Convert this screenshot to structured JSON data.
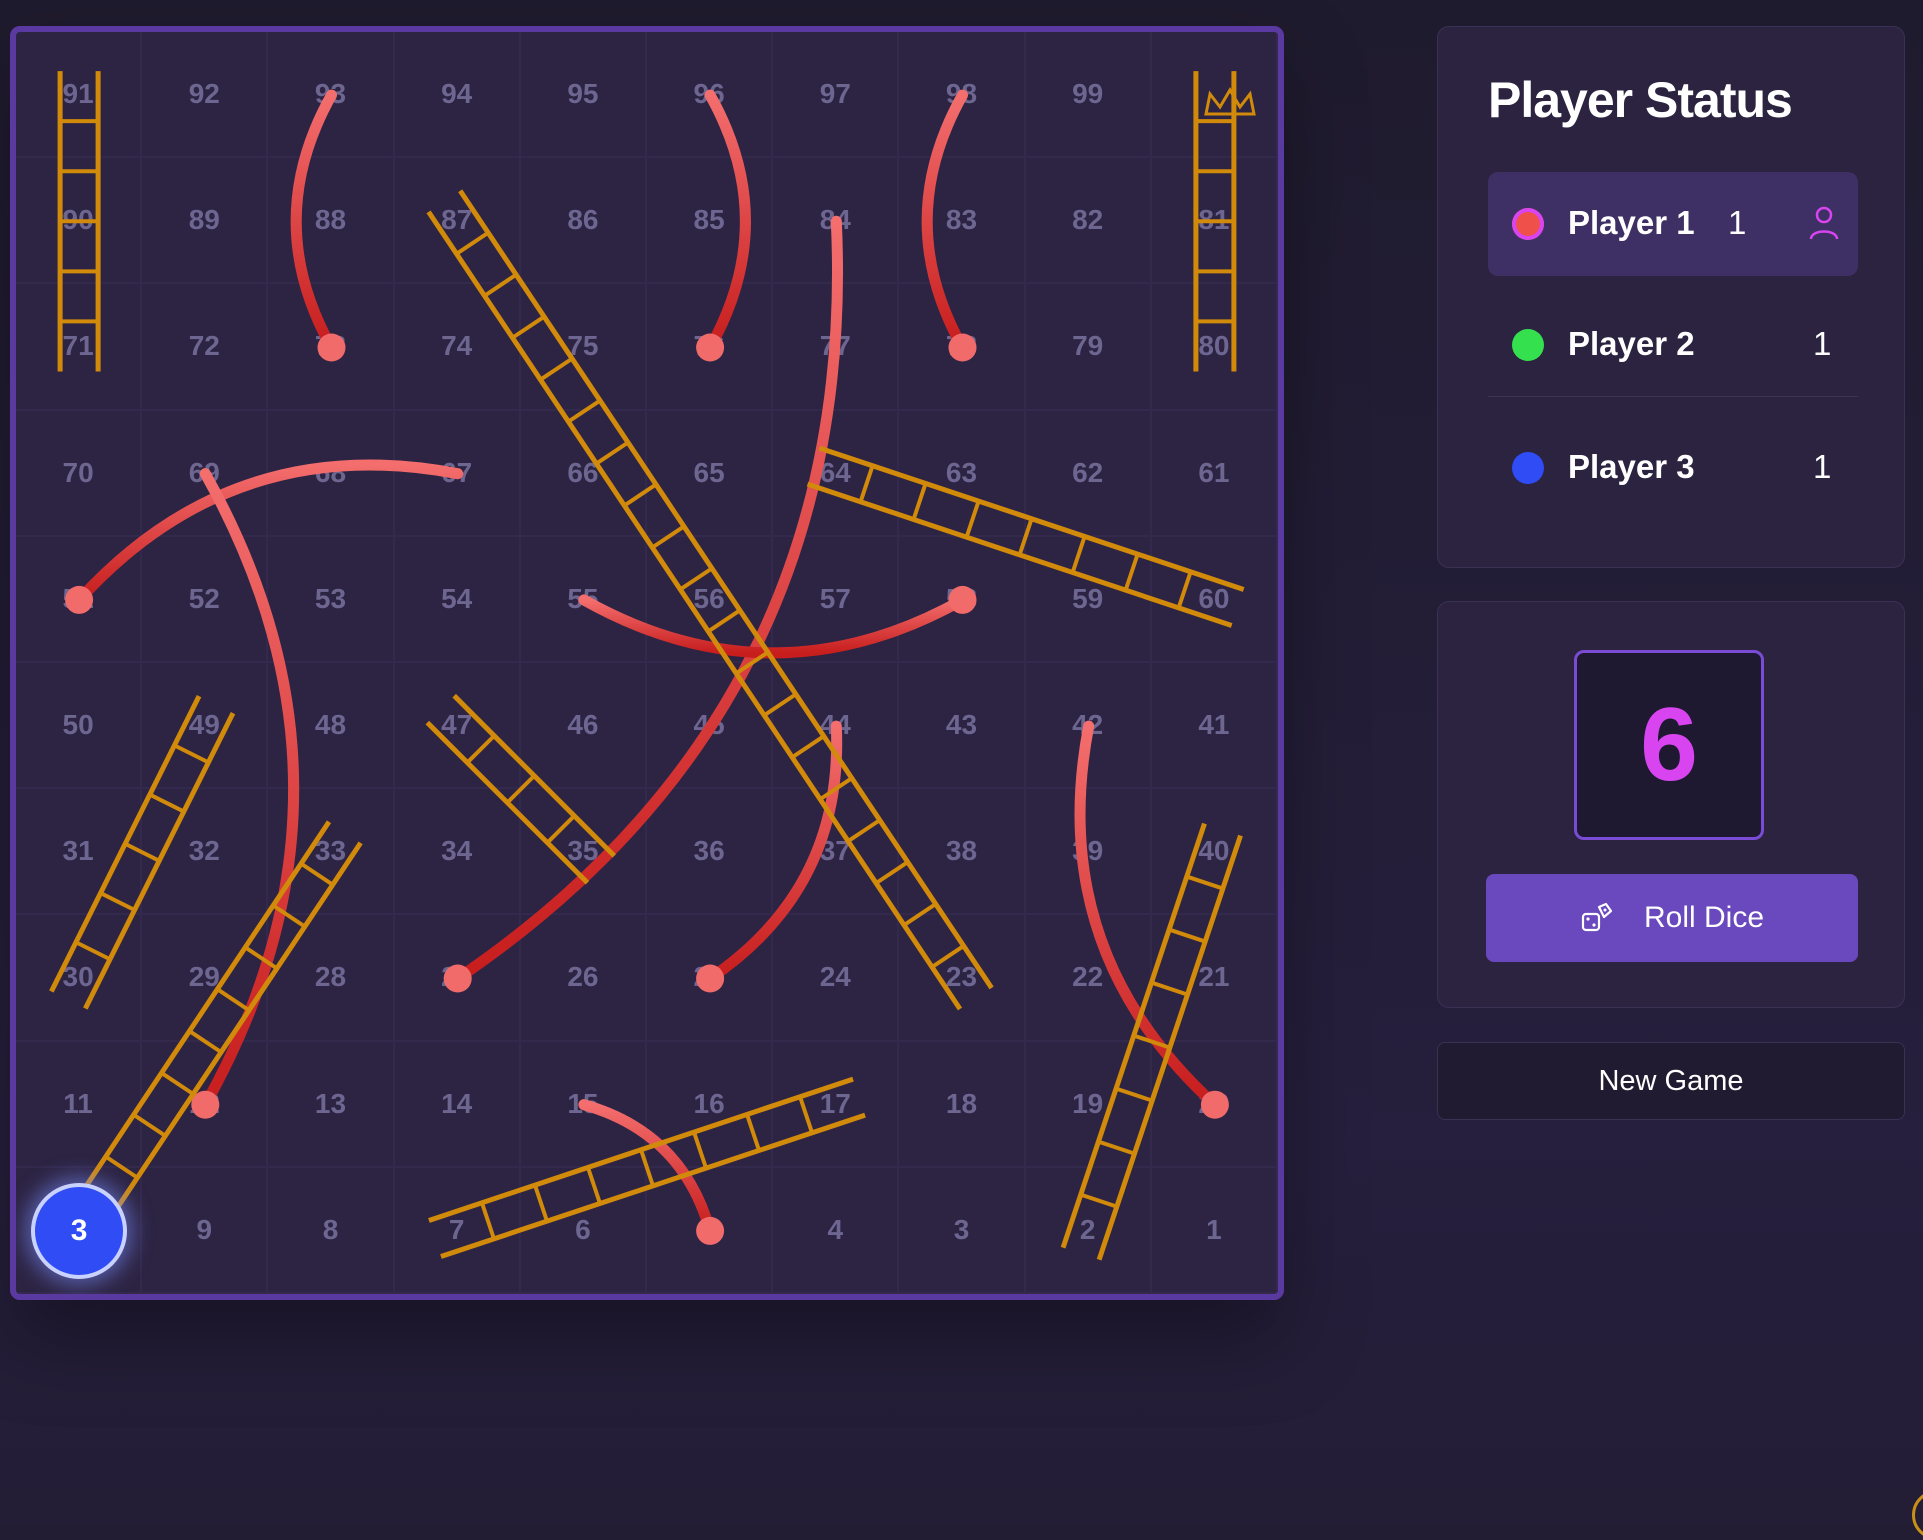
{
  "board": {
    "cells": [
      91,
      92,
      93,
      94,
      95,
      96,
      97,
      98,
      99,
      100,
      90,
      89,
      88,
      87,
      86,
      85,
      84,
      83,
      82,
      81,
      71,
      72,
      73,
      74,
      75,
      76,
      77,
      78,
      79,
      80,
      70,
      69,
      68,
      67,
      66,
      65,
      64,
      63,
      62,
      61,
      51,
      52,
      53,
      54,
      55,
      56,
      57,
      58,
      59,
      60,
      50,
      49,
      48,
      47,
      46,
      45,
      44,
      43,
      42,
      41,
      31,
      32,
      33,
      34,
      35,
      36,
      37,
      38,
      39,
      40,
      30,
      29,
      28,
      27,
      26,
      25,
      24,
      23,
      22,
      21,
      11,
      12,
      13,
      14,
      15,
      16,
      17,
      18,
      19,
      20,
      10,
      9,
      8,
      7,
      6,
      5,
      4,
      3,
      2,
      1
    ],
    "finish_icon": "crown-icon",
    "ladders": [
      {
        "from": 10,
        "to": 33
      },
      {
        "from": 30,
        "to": 49
      },
      {
        "from": 7,
        "to": 17
      },
      {
        "from": 2,
        "to": 40
      },
      {
        "from": 35,
        "to": 47
      },
      {
        "from": 23,
        "to": 87
      },
      {
        "from": 60,
        "to": 64
      },
      {
        "from": 71,
        "to": 91
      },
      {
        "from": 80,
        "to": 100
      }
    ],
    "snakes": [
      {
        "head": 93,
        "tail": 73
      },
      {
        "head": 96,
        "tail": 76
      },
      {
        "head": 98,
        "tail": 78
      },
      {
        "head": 84,
        "tail": 27
      },
      {
        "head": 67,
        "tail": 51
      },
      {
        "head": 69,
        "tail": 12
      },
      {
        "head": 55,
        "tail": 58
      },
      {
        "head": 44,
        "tail": 25
      },
      {
        "head": 42,
        "tail": 20
      },
      {
        "head": 15,
        "tail": 5
      }
    ],
    "tokens": [
      {
        "label": "3",
        "cell": 10,
        "color": "#2f4cf5"
      }
    ]
  },
  "status": {
    "title": "Player Status",
    "players": [
      {
        "name": "Player 1",
        "position": "1",
        "color": "#f0504a",
        "ring": "#d845f0",
        "active": true,
        "turn_icon": "user-icon"
      },
      {
        "name": "Player 2",
        "position": "1",
        "color": "#35e04f",
        "active": false
      },
      {
        "name": "Player 3",
        "position": "1",
        "color": "#2f4cf5",
        "active": false
      }
    ]
  },
  "dice": {
    "value": "6",
    "roll_label": "Roll Dice",
    "roll_icon": "dice-icon"
  },
  "new_game_label": "New Game",
  "colors": {
    "ladder": "#d18a0a",
    "snake_light": "#f26b6b",
    "snake_dark": "#c9201f",
    "accent": "#6a48bd"
  }
}
